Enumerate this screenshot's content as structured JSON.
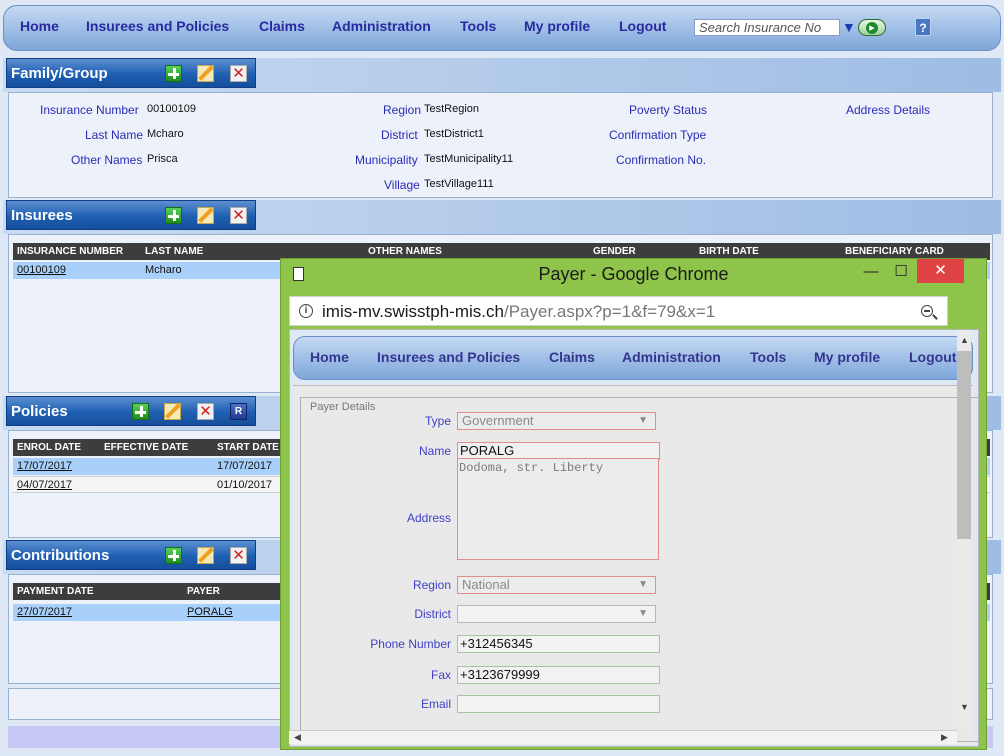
{
  "nav": {
    "items": [
      "Home",
      "Insurees and Policies",
      "Claims",
      "Administration",
      "Tools",
      "My profile",
      "Logout"
    ],
    "search_placeholder": "Search Insurance No",
    "help_label": "?"
  },
  "family": {
    "title": "Family/Group",
    "insurance_number_label": "Insurance Number",
    "insurance_number": "00100109",
    "last_name_label": "Last Name",
    "last_name": "Mcharo",
    "other_names_label": "Other Names",
    "other_names": "Prisca",
    "region_label": "Region",
    "region": "TestRegion",
    "district_label": "District",
    "district": "TestDistrict1",
    "municipality_label": "Municipality",
    "municipality": "TestMunicipality11",
    "village_label": "Village",
    "village": "TestVillage111",
    "poverty_status_label": "Poverty Status",
    "confirmation_type_label": "Confirmation Type",
    "confirmation_no_label": "Confirmation No.",
    "address_details_label": "Address Details"
  },
  "insurees": {
    "title": "Insurees",
    "columns": [
      "INSURANCE NUMBER",
      "LAST NAME",
      "OTHER NAMES",
      "GENDER",
      "BIRTH DATE",
      "BENEFICIARY CARD"
    ],
    "rows": [
      {
        "insurance_number": "00100109",
        "last_name": "Mcharo"
      }
    ]
  },
  "policies": {
    "title": "Policies",
    "columns": [
      "ENROL DATE",
      "EFFECTIVE DATE",
      "START DATE"
    ],
    "rows": [
      {
        "enrol_date": "17/07/2017",
        "effective_date": "",
        "start_date": "17/07/2017"
      },
      {
        "enrol_date": "04/07/2017",
        "effective_date": "",
        "start_date": "01/10/2017"
      }
    ],
    "renew_icon": "R"
  },
  "contributions": {
    "title": "Contributions",
    "columns": [
      "PAYMENT DATE",
      "PAYER"
    ],
    "rows": [
      {
        "payment_date": "27/07/2017",
        "payer": "PORALG"
      }
    ]
  },
  "popup": {
    "window_title": "Payer - Google Chrome",
    "url_host": "imis-mv.swisstph-mis.ch",
    "url_path": "/Payer.aspx?p=1&f=79&x=1",
    "minimize": "—",
    "maximize": "☐",
    "close": "✕",
    "inner_nav": [
      "Home",
      "Insurees and Policies",
      "Claims",
      "Administration",
      "Tools",
      "My profile",
      "Logout"
    ],
    "form": {
      "legend": "Payer Details",
      "type_label": "Type",
      "type_value": "Government",
      "name_label": "Name",
      "name_value": "PORALG",
      "address_label": "Address",
      "address_value": "Dodoma, str. Liberty",
      "region_label": "Region",
      "region_value": "National",
      "district_label": "District",
      "district_value": "",
      "phone_label": "Phone Number",
      "phone_value": "+312456345",
      "fax_label": "Fax",
      "fax_value": "+3123679999",
      "email_label": "Email",
      "email_value": ""
    }
  }
}
